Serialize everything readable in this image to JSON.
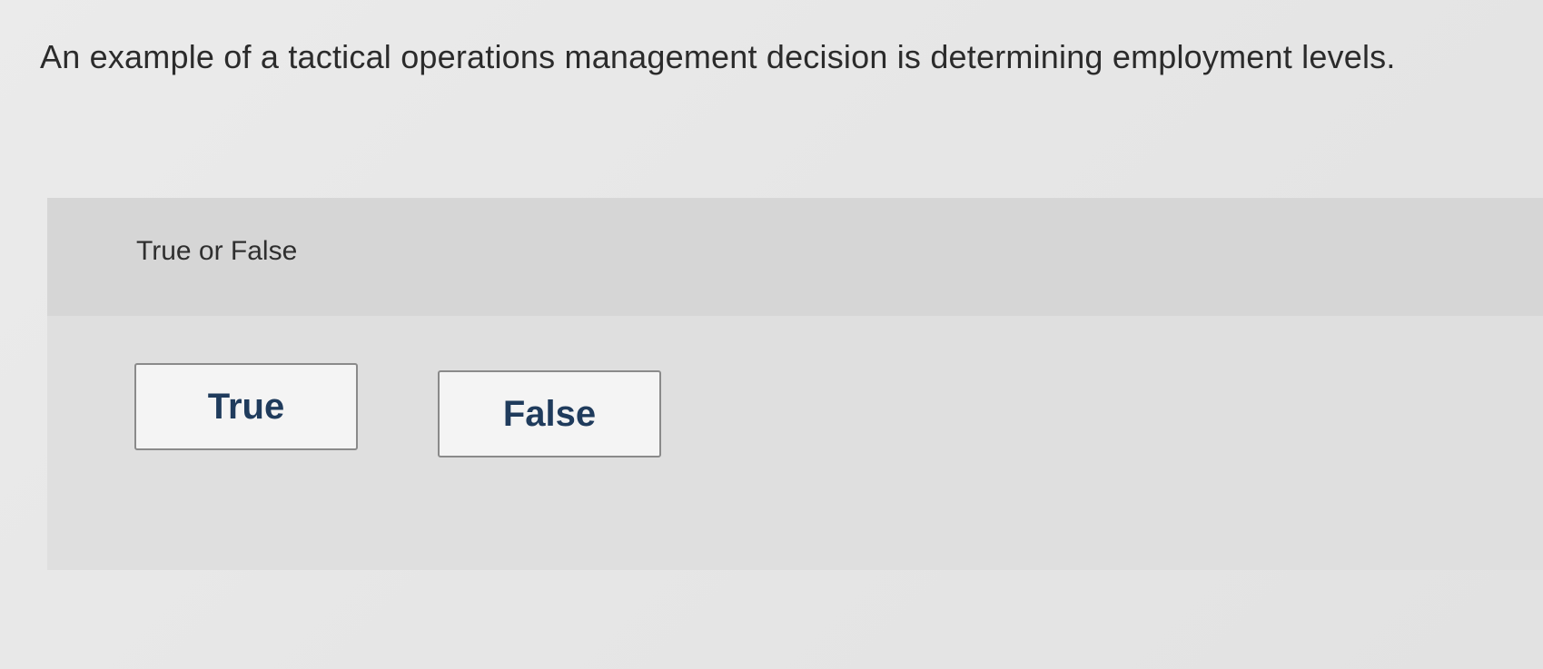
{
  "question": {
    "text": "An example of a tactical operations management decision is determining employment levels."
  },
  "answer_panel": {
    "instruction": "True or False",
    "choices": [
      {
        "label": "True"
      },
      {
        "label": "False"
      }
    ]
  },
  "colors": {
    "page_background": "#e6e6e6",
    "panel_background": "#dadada",
    "button_background": "#f4f4f4",
    "button_border": "#8a8a8a",
    "button_text": "#1f3b5c",
    "question_text": "#2b2b2b"
  }
}
